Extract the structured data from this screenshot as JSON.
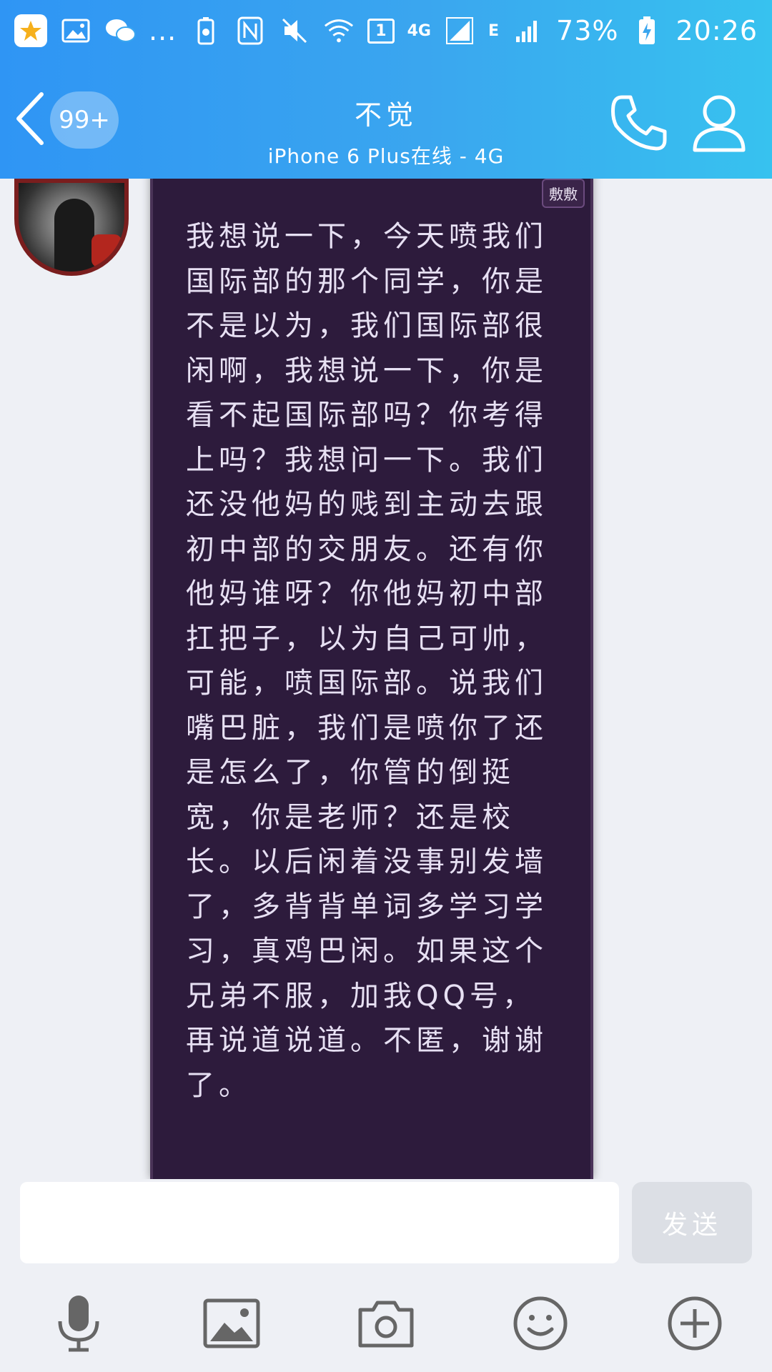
{
  "statusbar": {
    "more_indicator": "...",
    "sim_badge": "1",
    "net1": "4G",
    "net2": "E",
    "battery": "73%",
    "time": "20:26"
  },
  "header": {
    "unread_badge": "99+",
    "title": "不觉",
    "subtitle": "iPhone 6 Plus在线 - 4G"
  },
  "message": {
    "tag": "敷敷",
    "text": "我想说一下，今天喷我们国际部的那个同学，你是不是以为，我们国际部很闲啊，我想说一下，你是看不起国际部吗？你考得上吗？我想问一下。我们还没他妈的贱到主动去跟初中部的交朋友。还有你他妈谁呀？你他妈初中部扛把子，以为自己可帅，可能，喷国际部。说我们嘴巴脏，我们是喷你了还是怎么了，你管的倒挺宽，你是老师？还是校长。以后闲着没事别发墙了，多背背单词多学习学习，真鸡巴闲。如果这个兄弟不服，加我QQ号，再说道说道。不匿，谢谢了。"
  },
  "input": {
    "value": "",
    "placeholder": "",
    "send_label": "发送"
  },
  "colors": {
    "header_start": "#2f95f4",
    "header_end": "#37c2ef",
    "bubble_bg": "#2d1b3c",
    "bubble_text": "#e7e0f3"
  },
  "toolbar_icons": [
    "microphone-icon",
    "image-icon",
    "camera-icon",
    "emoji-icon",
    "plus-icon"
  ]
}
